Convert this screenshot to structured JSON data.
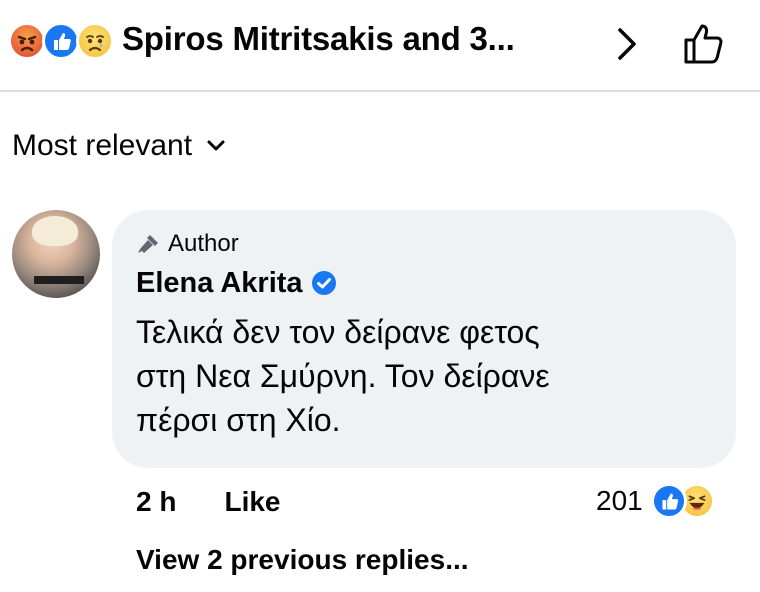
{
  "header": {
    "reactions": [
      "angry-reaction-icon",
      "like-reaction-icon",
      "sad-reaction-icon"
    ],
    "title": "Spiros Mitritsakis and 3..."
  },
  "sort": {
    "label": "Most relevant"
  },
  "comment": {
    "badge": "Author",
    "author_name": "Elena Akrita",
    "lines": [
      "Τελικά δεν τον δείρανε φετος",
      "στη Νεα Σμύρνη. Τον δείρανε",
      "πέρσι στη Χίο."
    ],
    "time": "2 h",
    "like_label": "Like",
    "reaction_count": "201",
    "reaction_icons": [
      "like-reaction-icon",
      "haha-reaction-icon"
    ]
  },
  "replies": {
    "label": "View 2 previous replies..."
  },
  "colors": {
    "accent": "#1877f2",
    "bubble": "#eff2f5",
    "divider": "#dadde1"
  }
}
